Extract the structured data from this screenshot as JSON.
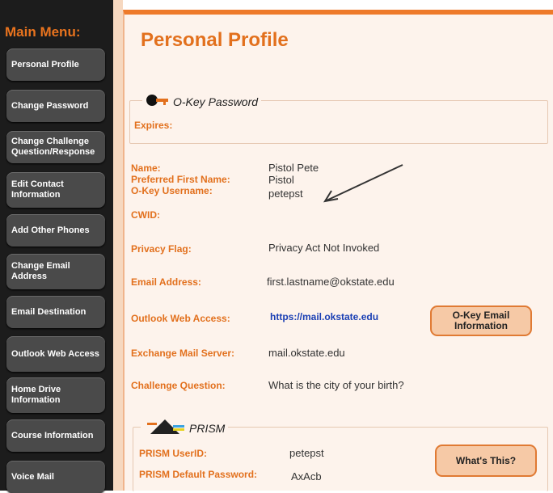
{
  "sidebar": {
    "title": "Main Menu:",
    "items": [
      {
        "label": "Personal Profile"
      },
      {
        "label": "Change Password"
      },
      {
        "label": "Change Challenge Question/Response"
      },
      {
        "label": "Edit Contact Information"
      },
      {
        "label": "Add Other Phones"
      },
      {
        "label": "Change Email Address"
      },
      {
        "label": "Email Destination"
      },
      {
        "label": "Outlook Web Access"
      },
      {
        "label": "Home Drive Information"
      },
      {
        "label": "Course Information"
      },
      {
        "label": "Voice Mail"
      }
    ]
  },
  "page": {
    "title": "Personal Profile"
  },
  "okey": {
    "legend": "O-Key Password",
    "expires_label": "Expires:"
  },
  "profile": {
    "name_label": "Name:",
    "name_value": "Pistol Pete",
    "first_label": "Preferred First Name:",
    "first_value": "Pistol",
    "username_label": "O-Key Username:",
    "username_value": "petepst",
    "cwid_label": "CWID:",
    "privacy_label": "Privacy Flag:",
    "privacy_value": "Privacy Act Not Invoked",
    "email_label": "Email Address:",
    "email_value": "first.lastname@okstate.edu",
    "owa_label": "Outlook Web Access:",
    "owa_link": "https://mail.okstate.edu",
    "okey_email_btn": "O-Key Email Information",
    "exchange_label": "Exchange Mail Server:",
    "exchange_value": "mail.okstate.edu",
    "challenge_label": "Challenge Question:",
    "challenge_value": "What is the city of your birth?"
  },
  "prism": {
    "legend": "PRISM",
    "userid_label": "PRISM UserID:",
    "userid_value": "petepst",
    "password_label": "PRISM Default Password:",
    "password_value": "AxAcb",
    "whats_this_btn": "What's This?"
  },
  "colors": {
    "accent": "#e2701d",
    "sidebar": "#1c1c1c",
    "button": "#4a4a4a",
    "panel": "#fdf3ec"
  }
}
